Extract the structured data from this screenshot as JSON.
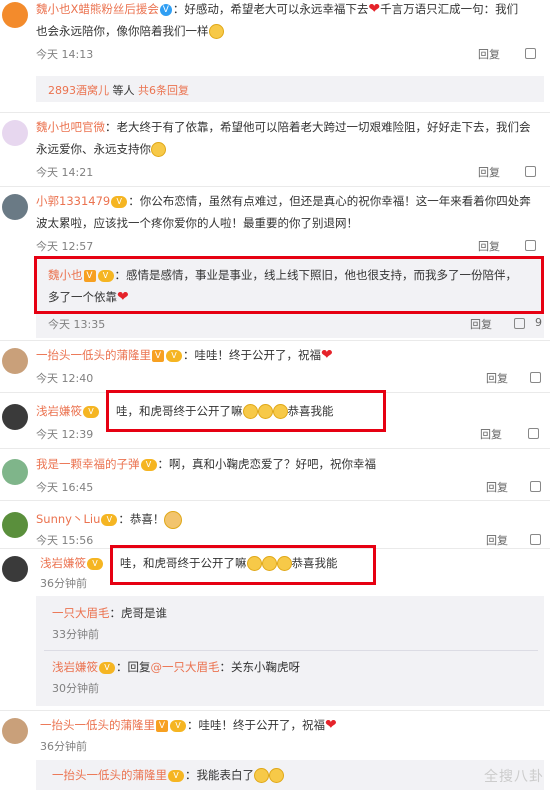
{
  "c1": {
    "name": "魏小也X蜡熊粉丝后援会",
    "text1": "：好感动，希望老大可以永远幸福下去",
    "text2": "千言万语只汇成一句：我们",
    "text3": "也会永远陪你，像你陪着我们一样",
    "time": "今天 14:13",
    "reply": "回复"
  },
  "c1_more": {
    "user": "2893酒窝儿",
    "mid": " 等人 ",
    "count": "共6条回复"
  },
  "c2": {
    "name": "魏小也吧官微",
    "text1": "：老大终于有了依靠，希望他可以陪着老大跨过一切艰难险阻，好好走下去，我们会",
    "text2": "永远爱你、永远支持你",
    "time": "今天 14:21",
    "reply": "回复"
  },
  "c3": {
    "name": "小郭1331479",
    "text1": "：你公布恋情，虽然有点难过，但还是真心的祝你幸福！这一年来看着你四处奔",
    "text2": "波太累啦，应该找一个疼你爱你的人啦！最重要的你了别退网！",
    "time": "今天 12:57",
    "reply": "回复"
  },
  "c3_reply": {
    "name": "魏小也",
    "text1": "：感情是感情，事业是事业，线上线下照旧，他也很支持，而我多了一份陪伴，",
    "text2": "多了一个依靠",
    "time": "今天 13:35",
    "reply": "回复",
    "likes": "9"
  },
  "c4": {
    "name": "一抬头一低头的蒲隆里",
    "text": "：哇哇！终于公开了，祝福",
    "time": "今天 12:40",
    "reply": "回复"
  },
  "c5": {
    "name": "浅岩嫌筱",
    "text": "哇，和虎哥终于公开了嘛",
    "text2": "恭喜我能",
    "time": "今天 12:39",
    "reply": "回复"
  },
  "c6": {
    "name": "我是一颗幸福的子弹",
    "text": "：啊，真和小鞠虎恋爱了？好吧，祝你幸福",
    "time": "今天 16:45",
    "reply": "回复"
  },
  "c7": {
    "name": "Sunny丶Liu",
    "text": "：恭喜！",
    "time": "今天 15:56",
    "reply": "回复"
  },
  "c8": {
    "name": "浅岩嫌筱",
    "text": "哇，和虎哥终于公开了嘛",
    "text2": "恭喜我能",
    "time": "36分钟前"
  },
  "c8_r1": {
    "name": "一只大眉毛",
    "text": "：虎哥是谁",
    "time": "33分钟前"
  },
  "c8_r2": {
    "name": "浅岩嫌筱",
    "mid": "：回复",
    "at": "@一只大眉毛",
    "text": "：关东小鞠虎呀",
    "time": "30分钟前"
  },
  "c9": {
    "name": "一抬头一低头的蒲隆里",
    "text": "：哇哇！终于公开了，祝福",
    "time": "36分钟前"
  },
  "c9_r1": {
    "name": "一抬头一低头的蒲隆里",
    "text": "：我能表白了"
  },
  "watermark": "全搜八卦"
}
